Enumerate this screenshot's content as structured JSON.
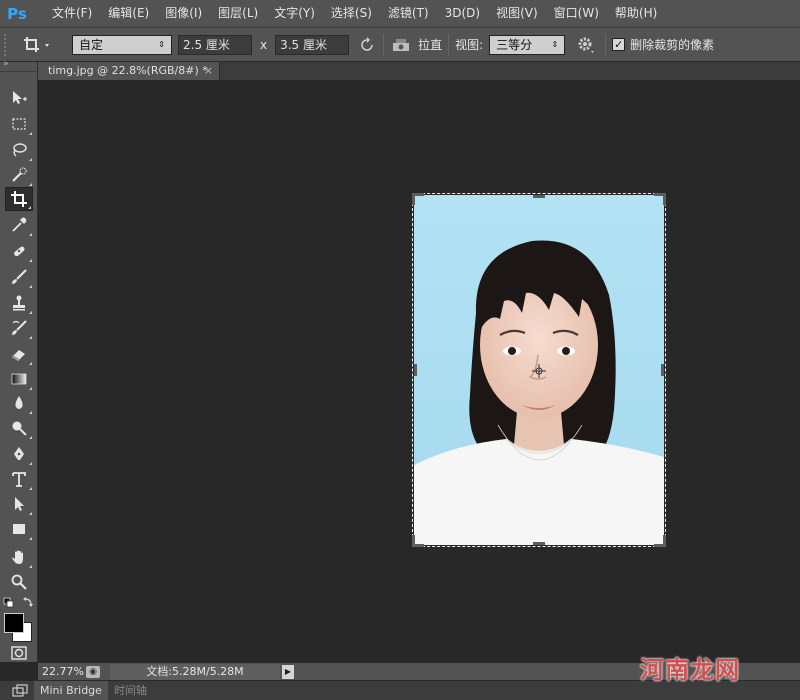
{
  "app": {
    "logo": "Ps"
  },
  "menu": [
    {
      "label": "文件(F)"
    },
    {
      "label": "编辑(E)"
    },
    {
      "label": "图像(I)"
    },
    {
      "label": "图层(L)"
    },
    {
      "label": "文字(Y)"
    },
    {
      "label": "选择(S)"
    },
    {
      "label": "滤镜(T)"
    },
    {
      "label": "3D(D)"
    },
    {
      "label": "视图(V)"
    },
    {
      "label": "窗口(W)"
    },
    {
      "label": "帮助(H)"
    }
  ],
  "options": {
    "ratio_select": "自定",
    "width_value": "2.5 厘米",
    "times_sign": "x",
    "height_value": "3.5 厘米",
    "straighten_label": "拉直",
    "view_label": "视图:",
    "view_select": "三等分",
    "delete_pixels_label": "删除裁剪的像素",
    "delete_pixels_checked": true
  },
  "document": {
    "tab_title": "timg.jpg @ 22.8%(RGB/8#) *",
    "tab_close": "×"
  },
  "status": {
    "zoom": "22.77%",
    "doc_info": "文档:5.28M/5.28M",
    "arrow": "▶"
  },
  "bottom_tabs": [
    {
      "label": "Mini Bridge"
    },
    {
      "label": "时间轴"
    }
  ],
  "watermark": "河南龙网",
  "colors": {
    "accent_logo": "#31a8ff",
    "photo_bg": "#ace0f2",
    "ui_gray": "#535353",
    "canvas_bg": "#282828"
  },
  "icons": {
    "toolbar": [
      "move-icon",
      "marquee-icon",
      "lasso-icon",
      "quick-select-icon",
      "crop-icon",
      "eyedropper-icon",
      "healing-brush-icon",
      "brush-icon",
      "clone-stamp-icon",
      "history-brush-icon",
      "eraser-icon",
      "gradient-icon",
      "blur-icon",
      "dodge-icon",
      "pen-icon",
      "type-icon",
      "path-select-icon",
      "rectangle-icon",
      "hand-icon",
      "zoom-icon"
    ]
  }
}
